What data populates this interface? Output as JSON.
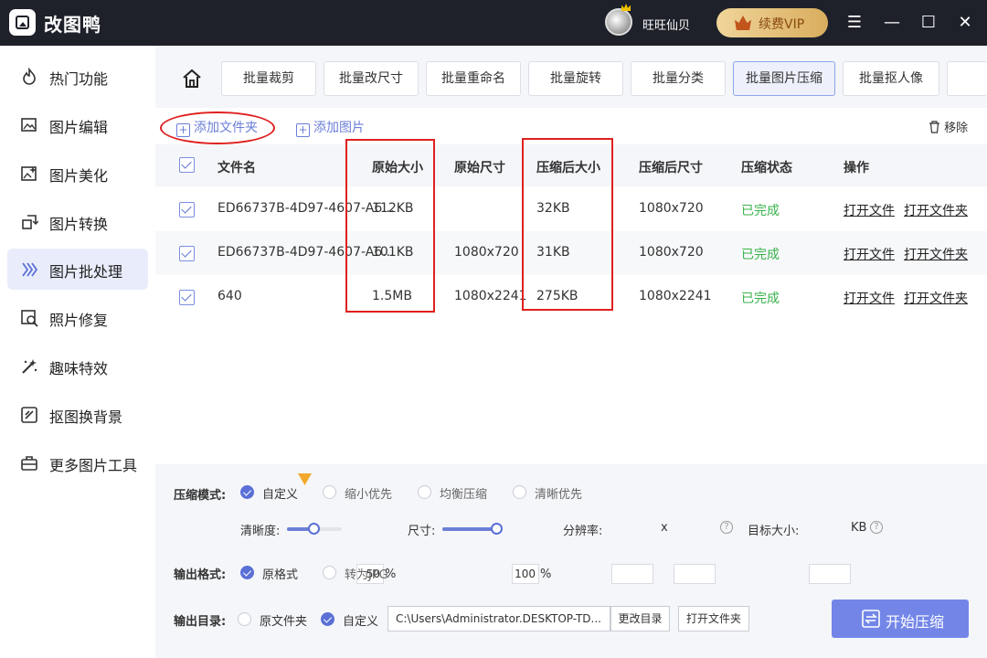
{
  "app": {
    "title": "改图鸭"
  },
  "user": {
    "name": "旺旺仙贝",
    "vip_label": "续费VIP"
  },
  "window_controls": {
    "menu": "☰",
    "minimize": "—",
    "maximize": "☐",
    "close": "✕"
  },
  "sidebar": {
    "items": [
      {
        "label": "热门功能",
        "icon": "flame-icon"
      },
      {
        "label": "图片编辑",
        "icon": "image-edit-icon"
      },
      {
        "label": "图片美化",
        "icon": "image-beautify-icon"
      },
      {
        "label": "图片转换",
        "icon": "convert-icon"
      },
      {
        "label": "图片批处理",
        "icon": "batch-icon"
      },
      {
        "label": "照片修复",
        "icon": "repair-icon"
      },
      {
        "label": "趣味特效",
        "icon": "magic-wand-icon"
      },
      {
        "label": "抠图换背景",
        "icon": "cutout-icon"
      },
      {
        "label": "更多图片工具",
        "icon": "toolbox-icon"
      }
    ],
    "active_index": 4
  },
  "toolbar": {
    "tools": [
      "批量裁剪",
      "批量改尺寸",
      "批量重命名",
      "批量旋转",
      "批量分类",
      "批量图片压缩",
      "批量抠人像"
    ],
    "active_tool": "批量图片压缩"
  },
  "actions": {
    "add_folder": "添加文件夹",
    "add_image": "添加图片",
    "remove": "移除"
  },
  "table": {
    "headers": [
      "文件名",
      "原始大小",
      "原始尺寸",
      "压缩后大小",
      "压缩后尺寸",
      "压缩状态",
      "操作"
    ],
    "rows": [
      {
        "name": "ED66737B-4D97-4607-A6...",
        "orig_size": "112KB",
        "orig_dim": "",
        "new_size": "32KB",
        "new_dim": "1080x720",
        "status": "已完成",
        "open_file": "打开文件",
        "open_folder": "打开文件夹"
      },
      {
        "name": "ED66737B-4D97-4607-A6...",
        "orig_size": "101KB",
        "orig_dim": "1080x720",
        "new_size": "31KB",
        "new_dim": "1080x720",
        "status": "已完成",
        "open_file": "打开文件",
        "open_folder": "打开文件夹"
      },
      {
        "name": "640",
        "orig_size": "1.5MB",
        "orig_dim": "1080x2241",
        "new_size": "275KB",
        "new_dim": "1080x2241",
        "status": "已完成",
        "open_file": "打开文件",
        "open_folder": "打开文件夹"
      }
    ]
  },
  "settings": {
    "mode_label": "压缩模式:",
    "modes": [
      "自定义",
      "缩小优先",
      "均衡压缩",
      "清晰优先"
    ],
    "clarity_label": "清晰度:",
    "clarity_value": "50",
    "clarity_fraction": 0.5,
    "size_label": "尺寸:",
    "size_value": "100",
    "size_fraction": 1.0,
    "percent": "%",
    "resolution_label": "分辨率:",
    "x_sep": "x",
    "target_label": "目标大小:",
    "target_unit": "KB",
    "help": "?",
    "format_label": "输出格式:",
    "formats": [
      "原格式",
      "转为JPG"
    ],
    "dir_label": "输出目录:",
    "dirs": [
      "原文件夹",
      "自定义"
    ],
    "path": "C:\\Users\\Administrator.DESKTOP-TD...",
    "change_dir": "更改目录",
    "open_folder": "打开文件夹",
    "start": "开始压缩"
  },
  "colors": {
    "accent": "#7386e8",
    "done": "#38b24a",
    "annotation": "#e02020",
    "vip": "#d9ad5e"
  }
}
